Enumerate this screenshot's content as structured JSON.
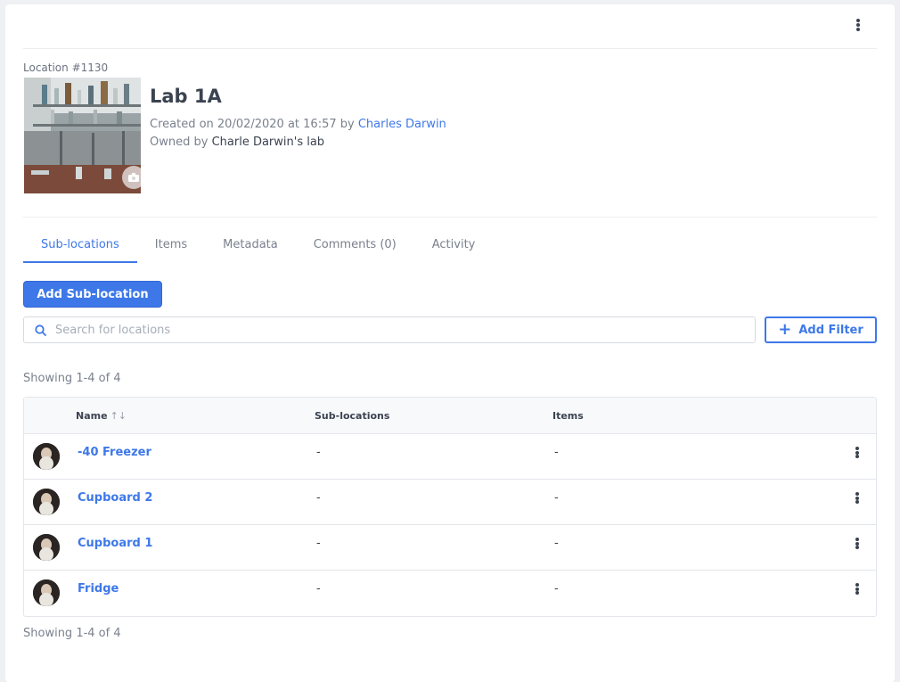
{
  "location": {
    "id_label": "Location #1130",
    "title": "Lab 1A",
    "created_prefix": "Created on 20/02/2020 at 16:57 by",
    "created_by": "Charles Darwin",
    "owned_prefix": "Owned by",
    "owned_by": "Charle Darwin's lab"
  },
  "tabs": [
    {
      "label": "Sub-locations",
      "active": true
    },
    {
      "label": "Items"
    },
    {
      "label": "Metadata"
    },
    {
      "label": "Comments (0)"
    },
    {
      "label": "Activity"
    }
  ],
  "actions": {
    "add_sublocation_label": "Add Sub-location",
    "add_filter_label": "Add Filter"
  },
  "search": {
    "placeholder": "Search for locations"
  },
  "pagination": {
    "top": "Showing 1-4 of 4",
    "bottom": "Showing 1-4 of 4"
  },
  "table": {
    "columns": {
      "name": "Name",
      "sublocations": "Sub-locations",
      "items": "Items"
    },
    "rows": [
      {
        "name": "-40 Freezer",
        "sublocations": "-",
        "items": "-"
      },
      {
        "name": "Cupboard 2",
        "sublocations": "-",
        "items": "-"
      },
      {
        "name": "Cupboard 1",
        "sublocations": "-",
        "items": "-"
      },
      {
        "name": "Fridge",
        "sublocations": "-",
        "items": "-"
      }
    ]
  },
  "icons": [
    "more-vertical-icon",
    "camera-icon",
    "search-icon",
    "plus-icon",
    "sort-icon"
  ],
  "colors": {
    "accent": "#3e78e8",
    "text": "#3b4350",
    "muted": "#7a818d"
  }
}
